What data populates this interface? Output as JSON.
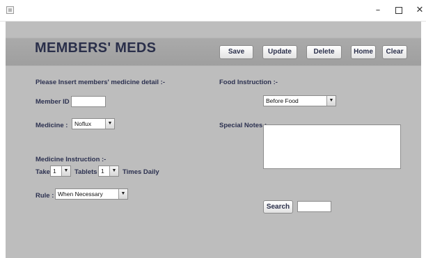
{
  "window": {
    "controls": {
      "minimize": "–",
      "maximize": "☐",
      "close": "✕"
    }
  },
  "header": {
    "title": "MEMBERS' MEDS",
    "buttons": {
      "save": "Save",
      "update": "Update",
      "delete": "Delete",
      "home": "Home",
      "clear": "Clear"
    }
  },
  "form": {
    "section_label": "Please Insert members' medicine detail :-",
    "member_id_label": "Member ID :",
    "member_id_value": "",
    "medicine_label": "Medicine  :",
    "medicine_selected": "Noflux",
    "medicine_instruction_label": "Medicine Instruction :-",
    "take_label": "Take",
    "take_selected": "1",
    "tablets_label": "Tablets",
    "times_selected": "1",
    "times_daily_label": "Times Daily",
    "rule_label": "Rule :",
    "rule_selected": "When Necessary",
    "food_instruction_label": "Food Instruction :-",
    "food_selected": "Before Food",
    "special_notes_label": "Special Notes :-",
    "special_notes_value": "",
    "search_button": "Search",
    "search_value": ""
  },
  "colors": {
    "background": "#bdbdbd",
    "header_band": "#a3a3a3",
    "title_text": "#2a2f4a"
  }
}
